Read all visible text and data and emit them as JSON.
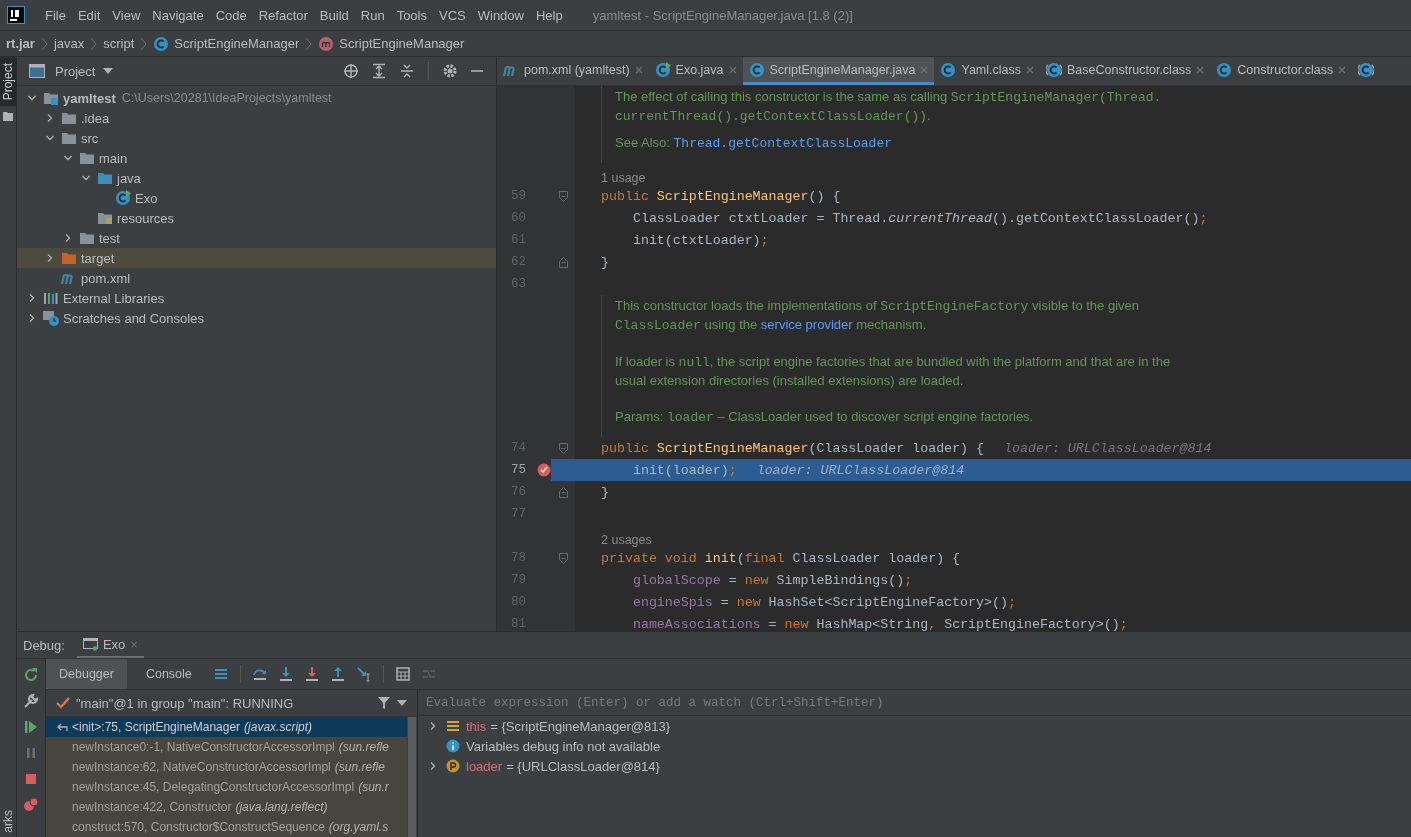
{
  "menu_bar": {
    "items": [
      "File",
      "Edit",
      "View",
      "Navigate",
      "Code",
      "Refactor",
      "Build",
      "Run",
      "Tools",
      "VCS",
      "Window",
      "Help"
    ],
    "title": "yamltest - ScriptEngineManager.java [1.8 (2)]"
  },
  "breadcrumbs": [
    {
      "label": "rt.jar",
      "kind": "root"
    },
    {
      "label": "javax",
      "kind": "package"
    },
    {
      "label": "script",
      "kind": "package"
    },
    {
      "label": "ScriptEngineManager",
      "kind": "class"
    },
    {
      "label": "ScriptEngineManager",
      "kind": "method"
    }
  ],
  "side_strip": {
    "top_tab": {
      "label": "Project",
      "selected": true
    },
    "bottom_tab": "arks"
  },
  "project": {
    "title": "Project",
    "tree": [
      {
        "label": "yamltest",
        "path": "C:\\Users\\20281\\IdeaProjects\\yamltest",
        "kind": "module",
        "expanded": true,
        "selected": false,
        "children": [
          {
            "label": ".idea",
            "kind": "folder",
            "expanded": false,
            "selected": false
          },
          {
            "label": "src",
            "kind": "folder",
            "expanded": true,
            "selected": false,
            "children": [
              {
                "label": "main",
                "kind": "folder",
                "expanded": true,
                "selected": false,
                "children": [
                  {
                    "label": "java",
                    "kind": "srcfolder",
                    "expanded": true,
                    "selected": false,
                    "children": [
                      {
                        "label": "Exo",
                        "kind": "runclass",
                        "selected": false
                      }
                    ]
                  },
                  {
                    "label": "resources",
                    "kind": "resfolder",
                    "selected": false
                  }
                ]
              },
              {
                "label": "test",
                "kind": "folder",
                "expanded": false,
                "selected": false
              }
            ]
          },
          {
            "label": "target",
            "kind": "excluded",
            "expanded": false,
            "selected": true
          },
          {
            "label": "pom.xml",
            "kind": "maven",
            "selected": false
          }
        ]
      },
      {
        "label": "External Libraries",
        "kind": "libraries",
        "expanded": false,
        "selected": false
      },
      {
        "label": "Scratches and Consoles",
        "kind": "scratches",
        "expanded": false,
        "selected": false
      }
    ]
  },
  "editor": {
    "tabs": [
      {
        "label": "pom.xml (yamltest)",
        "kind": "maven",
        "selected": false
      },
      {
        "label": "Exo.java",
        "kind": "runclass",
        "selected": false
      },
      {
        "label": "ScriptEngineManager.java",
        "kind": "class",
        "selected": true
      },
      {
        "label": "Yaml.class",
        "kind": "class",
        "selected": false
      },
      {
        "label": "BaseConstructor.class",
        "kind": "abstract",
        "selected": false
      },
      {
        "label": "Constructor.class",
        "kind": "class",
        "selected": false
      },
      {
        "kind": "abstract",
        "selected": false
      }
    ],
    "content": [
      {
        "kind": "doc",
        "paragraphs": [
          {
            "kind": "lines",
            "lines": [
              [
                {
                  "text": "The effect of calling this constructor is the same as calling ",
                  "kind": "text"
                },
                {
                  "text": "ScriptEngineManager(Thread.",
                  "kind": "code"
                }
              ],
              [
                {
                  "text": "currentThread().getContextClassLoader())",
                  "kind": "code"
                },
                {
                  "text": ".",
                  "kind": "text"
                }
              ]
            ]
          },
          {
            "kind": "seealso",
            "label": "See Also:",
            "link": "Thread.getContextClassLoader"
          }
        ]
      },
      {
        "kind": "usage",
        "text": "1 usage"
      },
      {
        "kind": "code",
        "number": "59",
        "fold_start": true,
        "tokens": [
          {
            "text": "public ",
            "kind": "kw"
          },
          {
            "text": "ScriptEngineManager",
            "kind": "fn"
          },
          {
            "text": "() {",
            "kind": "plain"
          }
        ]
      },
      {
        "kind": "code",
        "number": "60",
        "tokens": [
          {
            "text": "    ClassLoader ctxtLoader = Thread.",
            "kind": "plain"
          },
          {
            "text": "currentThread",
            "kind": "ital"
          },
          {
            "text": "().getContextClassLoader()",
            "kind": "plain"
          },
          {
            "text": ";",
            "kind": "kw"
          }
        ]
      },
      {
        "kind": "code",
        "number": "61",
        "tokens": [
          {
            "text": "    init(ctxtLoader)",
            "kind": "plain"
          },
          {
            "text": ";",
            "kind": "kw"
          }
        ]
      },
      {
        "kind": "code",
        "number": "62",
        "fold_end": true,
        "tokens": [
          {
            "text": "}",
            "kind": "plain"
          }
        ]
      },
      {
        "kind": "code",
        "number": "63"
      },
      {
        "kind": "doc",
        "paragraphs": [
          {
            "kind": "lines",
            "lines": [
              [
                {
                  "text": "This constructor loads the implementations of ",
                  "kind": "text"
                },
                {
                  "text": "ScriptEngineFactory",
                  "kind": "code"
                },
                {
                  "text": " visible to the given",
                  "kind": "text"
                }
              ],
              [
                {
                  "text": "ClassLoader",
                  "kind": "code"
                },
                {
                  "text": " using the ",
                  "kind": "text"
                },
                {
                  "text": "service provider",
                  "kind": "link"
                },
                {
                  "text": " mechanism.",
                  "kind": "text"
                }
              ]
            ]
          },
          {
            "kind": "lines",
            "lines": [
              [
                {
                  "text": "If loader is ",
                  "kind": "text"
                },
                {
                  "text": "null",
                  "kind": "code"
                },
                {
                  "text": ", the script engine factories that are bundled with the platform and that are in the",
                  "kind": "text"
                }
              ],
              [
                {
                  "text": "usual extension directories (installed extensions) are loaded.",
                  "kind": "text"
                }
              ]
            ]
          },
          {
            "kind": "lines",
            "lines": [
              [
                {
                  "text": "Params: ",
                  "kind": "text"
                },
                {
                  "text": "loader",
                  "kind": "code"
                },
                {
                  "text": " – ClassLoader used to discover script engine factories.",
                  "kind": "text"
                }
              ]
            ]
          }
        ]
      },
      {
        "kind": "code",
        "number": "74",
        "fold_start": true,
        "hint": "loader: URLClassLoader@814",
        "tokens": [
          {
            "text": "public ",
            "kind": "kw"
          },
          {
            "text": "ScriptEngineManager",
            "kind": "fn"
          },
          {
            "text": "(ClassLoader loader) {",
            "kind": "plain"
          }
        ]
      },
      {
        "kind": "code",
        "number": "75",
        "breakpoint": true,
        "current": true,
        "hint": "loader: URLClassLoader@814",
        "tokens": [
          {
            "text": "    init(loader)",
            "kind": "plain"
          },
          {
            "text": ";",
            "kind": "kw"
          }
        ]
      },
      {
        "kind": "code",
        "number": "76",
        "fold_end": true,
        "tokens": [
          {
            "text": "}",
            "kind": "plain"
          }
        ]
      },
      {
        "kind": "code",
        "number": "77"
      },
      {
        "kind": "usage",
        "text": "2 usages"
      },
      {
        "kind": "code",
        "number": "78",
        "fold_start": true,
        "tokens": [
          {
            "text": "private void ",
            "kind": "kw"
          },
          {
            "text": "init",
            "kind": "fn"
          },
          {
            "text": "(",
            "kind": "plain"
          },
          {
            "text": "final ",
            "kind": "kw"
          },
          {
            "text": "ClassLoader loader) {",
            "kind": "plain"
          }
        ]
      },
      {
        "kind": "code",
        "number": "79",
        "tokens": [
          {
            "text": "    globalScope",
            "kind": "field"
          },
          {
            "text": " = ",
            "kind": "plain"
          },
          {
            "text": "new ",
            "kind": "kw"
          },
          {
            "text": "SimpleBindings()",
            "kind": "plain"
          },
          {
            "text": ";",
            "kind": "kw"
          }
        ]
      },
      {
        "kind": "code",
        "number": "80",
        "tokens": [
          {
            "text": "    engineSpis",
            "kind": "field"
          },
          {
            "text": " = ",
            "kind": "plain"
          },
          {
            "text": "new ",
            "kind": "kw"
          },
          {
            "text": "HashSet<ScriptEngineFactory>()",
            "kind": "plain"
          },
          {
            "text": ";",
            "kind": "kw"
          }
        ]
      },
      {
        "kind": "code",
        "number": "81",
        "tokens": [
          {
            "text": "    nameAssociations",
            "kind": "field"
          },
          {
            "text": " = ",
            "kind": "plain"
          },
          {
            "text": "new ",
            "kind": "kw"
          },
          {
            "text": "HashMap<String",
            "kind": "plain"
          },
          {
            "text": ", ",
            "kind": "kw"
          },
          {
            "text": "ScriptEngineFactory>()",
            "kind": "plain"
          },
          {
            "text": ";",
            "kind": "kw"
          }
        ]
      }
    ]
  },
  "debug": {
    "label": "Debug:",
    "session_tab": {
      "label": "Exo",
      "close": "×"
    },
    "tabs": [
      {
        "label": "Debugger",
        "selected": true
      },
      {
        "label": "Console",
        "selected": false
      }
    ],
    "thread": "\"main\"@1 in group \"main\": RUNNING",
    "frames": [
      {
        "method": "<init>:75, ScriptEngineManager",
        "package": "(javax.script)",
        "selected": true,
        "library": false
      },
      {
        "method": "newInstance0:-1, NativeConstructorAccessorImpl",
        "package": "(sun.refle",
        "selected": false,
        "library": true
      },
      {
        "method": "newInstance:62, NativeConstructorAccessorImpl",
        "package": "(sun.refle",
        "selected": false,
        "library": true
      },
      {
        "method": "newInstance:45, DelegatingConstructorAccessorImpl",
        "package": "(sun.r",
        "selected": false,
        "library": true
      },
      {
        "method": "newInstance:422, Constructor",
        "package": "(java.lang.reflect)",
        "selected": false,
        "library": true
      },
      {
        "method": "construct:570, Constructor$ConstructSequence",
        "package": "(org.yaml.s",
        "selected": false,
        "library": true
      }
    ],
    "watch": {
      "placeholder": "Evaluate expression (Enter) or add a watch (Ctrl+Shift+Enter)"
    },
    "variables": [
      {
        "kind": "field",
        "name": "this",
        "value": "= {ScriptEngineManager@813}",
        "expanded": false
      },
      {
        "kind": "info",
        "text": "Variables debug info not available"
      },
      {
        "kind": "param",
        "name": "loader",
        "value": "= {URLClassLoader@814}",
        "expanded": false
      }
    ]
  }
}
